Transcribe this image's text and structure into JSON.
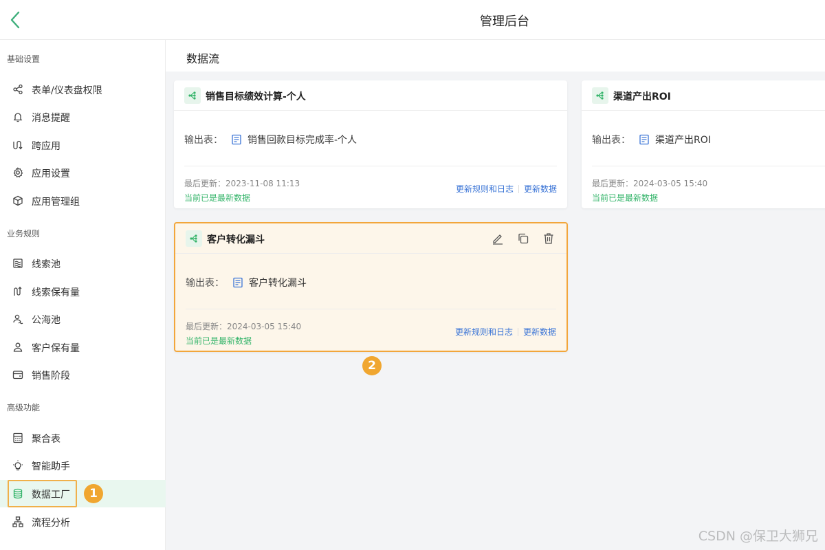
{
  "header": {
    "title": "管理后台"
  },
  "sidebar": {
    "groups": [
      {
        "title": "基础设置",
        "items": [
          {
            "label": "表单/仪表盘权限",
            "icon": "share-icon"
          },
          {
            "label": "消息提醒",
            "icon": "bell-icon"
          },
          {
            "label": "跨应用",
            "icon": "cross-app-icon"
          },
          {
            "label": "应用设置",
            "icon": "gear-icon"
          },
          {
            "label": "应用管理组",
            "icon": "cube-icon"
          }
        ]
      },
      {
        "title": "业务规则",
        "items": [
          {
            "label": "线索池",
            "icon": "lead-pool-icon"
          },
          {
            "label": "线索保有量",
            "icon": "lead-hold-icon"
          },
          {
            "label": "公海池",
            "icon": "public-pool-icon"
          },
          {
            "label": "客户保有量",
            "icon": "customer-icon"
          },
          {
            "label": "销售阶段",
            "icon": "wallet-icon"
          }
        ]
      },
      {
        "title": "高级功能",
        "items": [
          {
            "label": "聚合表",
            "icon": "calculator-icon"
          },
          {
            "label": "智能助手",
            "icon": "bulb-icon"
          },
          {
            "label": "数据工厂",
            "icon": "database-icon",
            "active": true
          },
          {
            "label": "流程分析",
            "icon": "flow-icon"
          }
        ]
      }
    ]
  },
  "main": {
    "title": "数据流",
    "cards": [
      {
        "title": "销售目标绩效计算-个人",
        "output_label": "输出表：",
        "output_name": "销售回款目标完成率-个人",
        "updated": "最后更新：2023-11-08 11:13",
        "status": "当前已是最新数据",
        "link1": "更新规则和日志",
        "link2": "更新数据"
      },
      {
        "title": "渠道产出ROI",
        "output_label": "输出表：",
        "output_name": "渠道产出ROI",
        "updated": "最后更新：2024-03-05 15:40",
        "status": "当前已是最新数据",
        "link1": "更新规则和日志",
        "link2": "更新数据"
      },
      {
        "title": "客户转化漏斗",
        "output_label": "输出表：",
        "output_name": "客户转化漏斗",
        "updated": "最后更新：2024-03-05 15:40",
        "status": "当前已是最新数据",
        "link1": "更新规则和日志",
        "link2": "更新数据"
      }
    ]
  },
  "annotations": {
    "badge1": "1",
    "badge2": "2"
  },
  "watermark": "CSDN @保卫大狮兄",
  "colors": {
    "accent": "#34b46a",
    "link": "#3a74d6",
    "highlight": "#f2a63b"
  }
}
